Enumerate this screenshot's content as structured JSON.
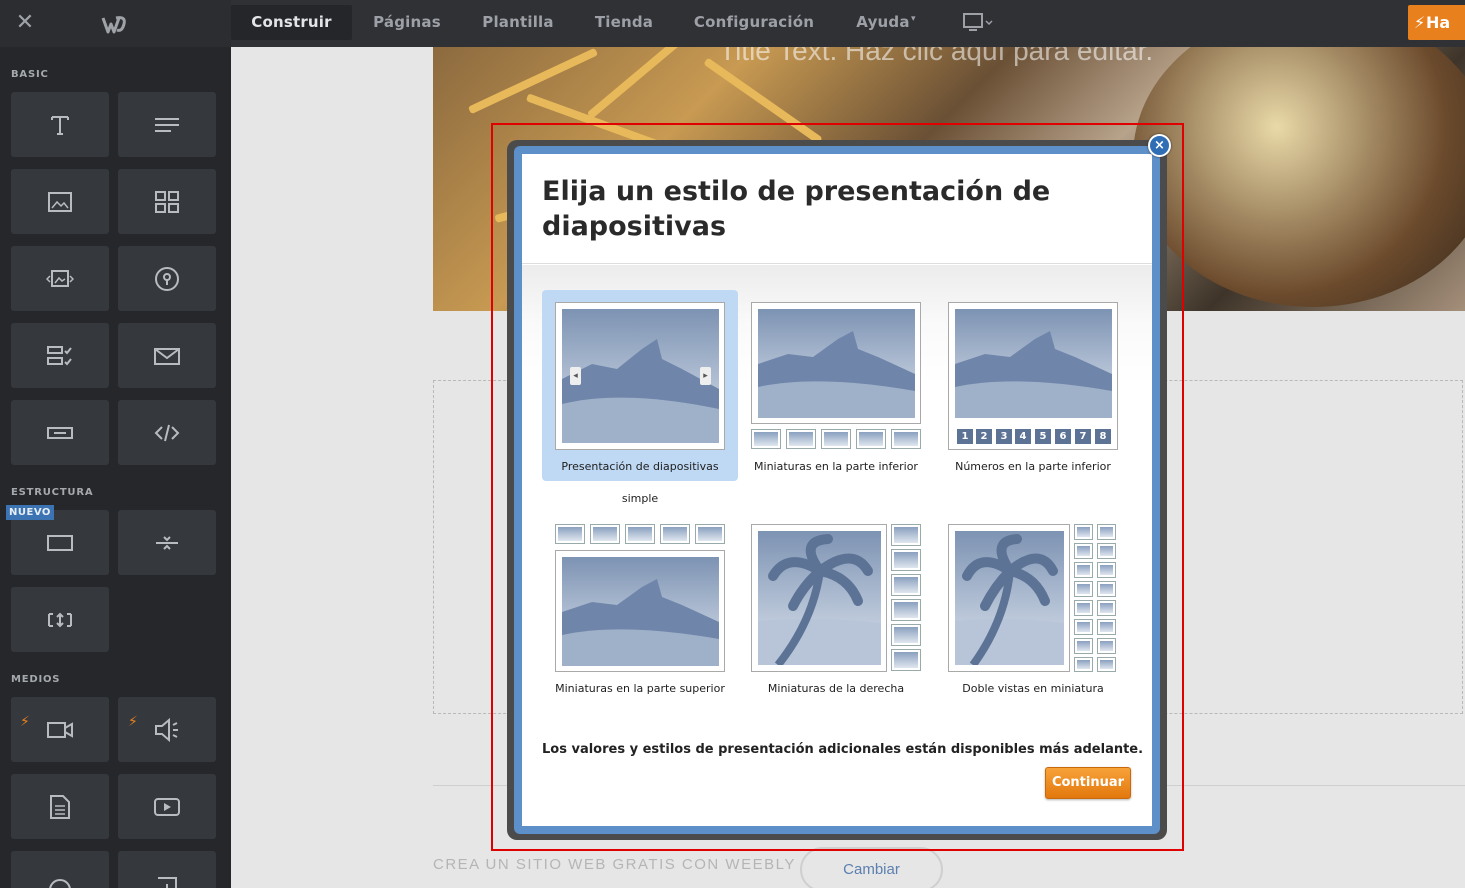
{
  "topbar": {
    "nav": [
      "Construir",
      "Páginas",
      "Plantilla",
      "Tienda",
      "Configuración",
      "Ayuda"
    ],
    "upgrade_label": "Ha"
  },
  "sidebar": {
    "basic_label": "BASIC",
    "structure_label": "ESTRUCTURA",
    "media_label": "MEDIOS",
    "new_badge": "NUEVO"
  },
  "canvas": {
    "hero_title": "Title Text. Haz clic aquí para editar.",
    "footer_text": "CREA UN SITIO WEB GRATIS CON WEEBLY",
    "change_button": "Cambiar"
  },
  "modal": {
    "title": "Elija un estilo de presentación de diapositivas",
    "close_label": "×",
    "options": [
      {
        "label": "Presentación de diapositivas",
        "sublabel": "simple"
      },
      {
        "label": "Miniaturas en la parte inferior"
      },
      {
        "label": "Números en la parte inferior"
      },
      {
        "label": "Miniaturas en la parte superior"
      },
      {
        "label": "Miniaturas de la derecha"
      },
      {
        "label": "Doble vistas en miniatura"
      }
    ],
    "numbers": [
      "1",
      "2",
      "3",
      "4",
      "5",
      "6",
      "7",
      "8"
    ],
    "note": "Los valores y estilos de presentación adicionales están disponibles más adelante.",
    "continue_label": "Continuar"
  },
  "colors": {
    "accent": "#e8801d",
    "modal_blue": "#5d8fc9",
    "selected_bg": "#bfd9f4",
    "highlight": "#e00000"
  }
}
